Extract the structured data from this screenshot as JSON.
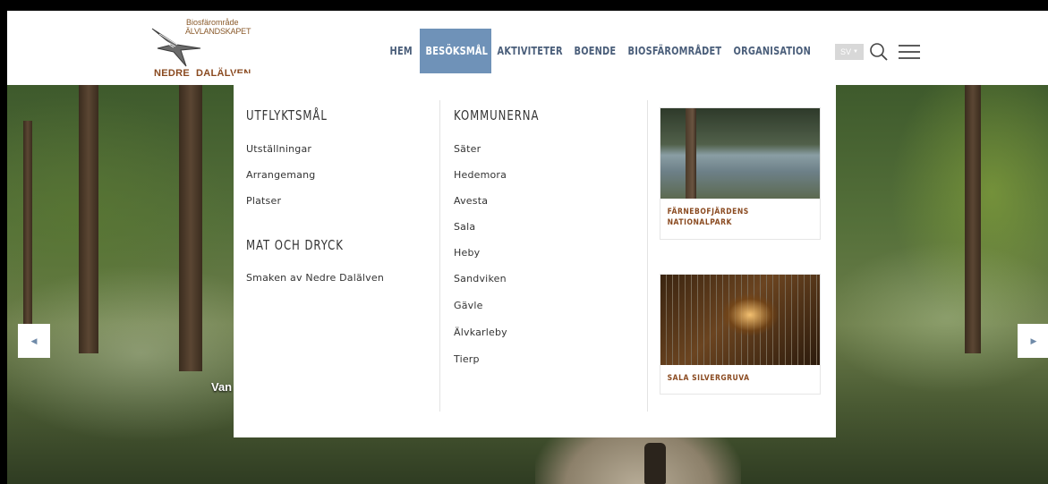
{
  "logo": {
    "line1": "Biosfärområde",
    "line2": "ÄLVLANDSKAPET",
    "line3": "NEDRE",
    "line4": "DALÄLVEN"
  },
  "nav": {
    "items": [
      "HEM",
      "BESÖKSMÅL",
      "AKTIVITETER",
      "BOENDE",
      "BIOSFÄROMRÅDET",
      "ORGANISATION"
    ],
    "active_index": 1
  },
  "language": "SV",
  "icons": {
    "search": "search-icon",
    "menu": "hamburger-menu-icon",
    "prev": "chevron-left-icon",
    "next": "chevron-right-icon"
  },
  "dropdown": {
    "col1": {
      "heading": "UTFLYKTSMÅL",
      "links": [
        "Utställningar",
        "Arrangemang",
        "Platser"
      ],
      "heading2": "MAT OCH DRYCK",
      "links2": [
        "Smaken av Nedre Dalälven"
      ]
    },
    "col2": {
      "heading": "KOMMUNERNA",
      "links": [
        "Säter",
        "Hedemora",
        "Avesta",
        "Sala",
        "Heby",
        "Sandviken",
        "Gävle",
        "Älvkarleby",
        "Tierp"
      ]
    },
    "cards": [
      {
        "caption_l1": "FÄRNEBOFJÄRDENS",
        "caption_l2": "NATIONALPARK"
      },
      {
        "caption_l1": "SALA SILVERGRUVA"
      }
    ]
  },
  "hero": {
    "caption": "Van"
  },
  "colors": {
    "nav_text": "#4a5e7a",
    "nav_active_bg": "#6f92b8",
    "brand_brown": "#8a4a20"
  }
}
